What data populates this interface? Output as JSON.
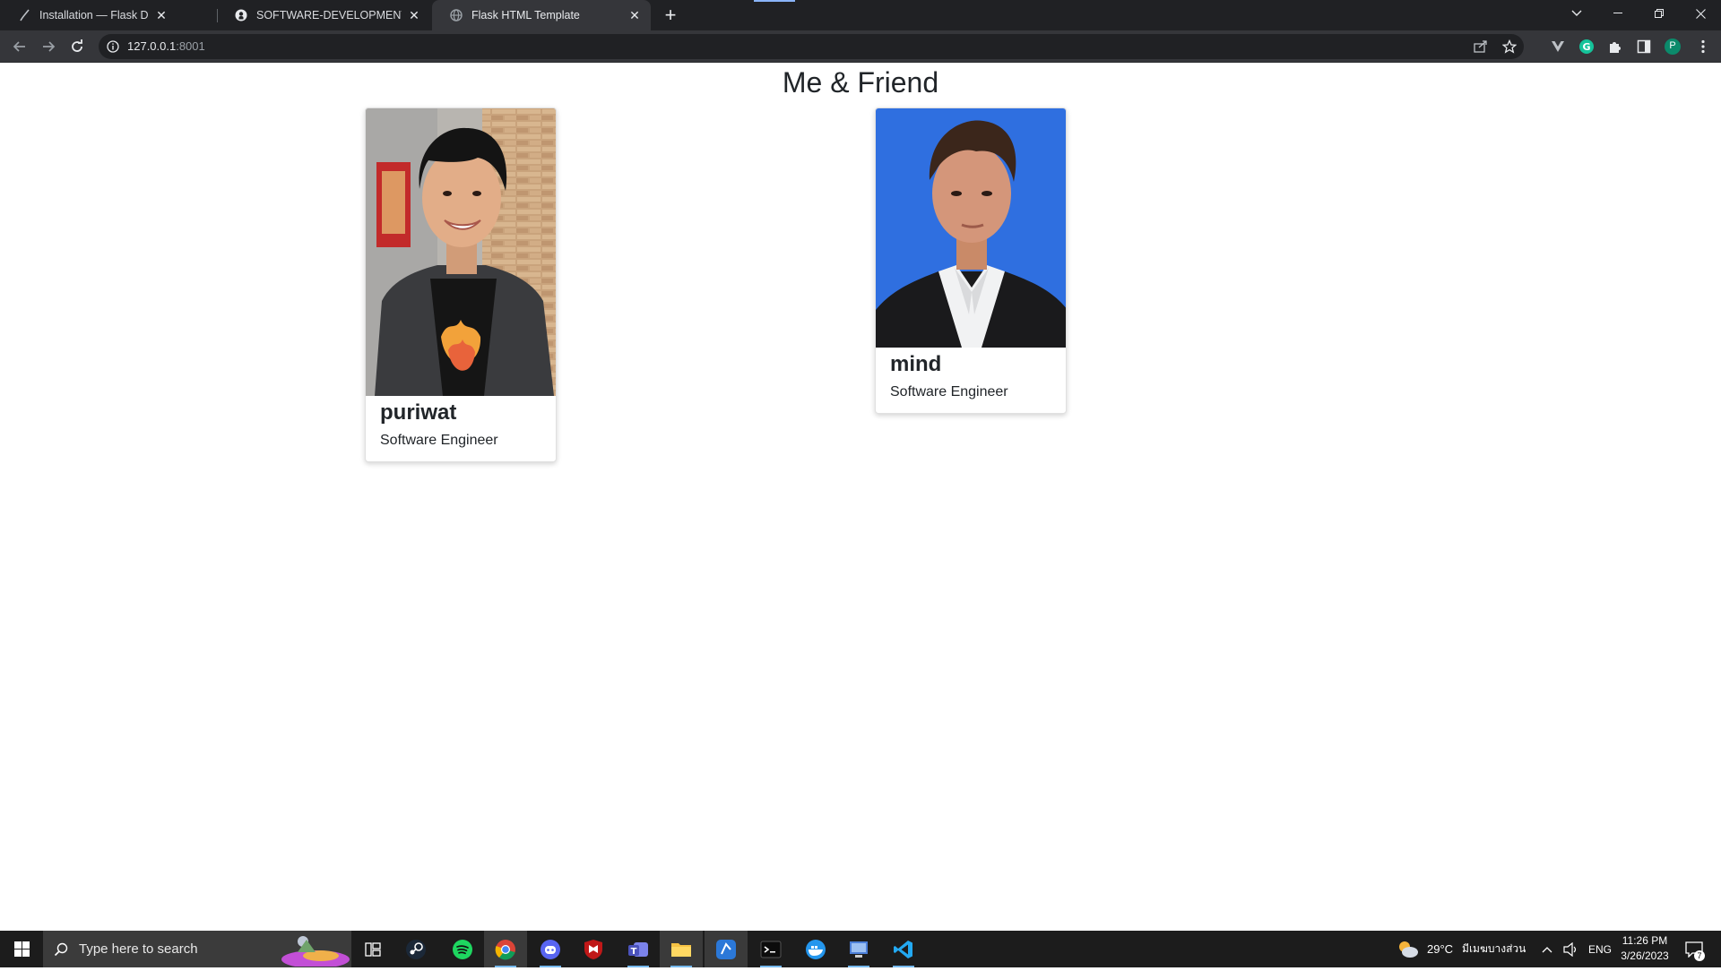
{
  "browser": {
    "tabs": [
      {
        "title": "Installation — Flask Documentati",
        "favicon": "flask-icon"
      },
      {
        "title": "SOFTWARE-DEVELOPMENT-TOO",
        "favicon": "github-icon"
      },
      {
        "title": "Flask HTML Template",
        "favicon": "globe-icon"
      }
    ],
    "url_host": "127.0.0.1",
    "url_port": ":8001",
    "profile_initial": "P"
  },
  "page": {
    "title": "Me & Friend",
    "cards": [
      {
        "name": "puriwat",
        "role": "Software Engineer"
      },
      {
        "name": "mind",
        "role": "Software Engineer"
      }
    ]
  },
  "taskbar": {
    "search_placeholder": "Type here to search",
    "weather_temp": "29°C",
    "weather_desc": "มีเมฆบางส่วน",
    "language": "ENG",
    "time": "11:26 PM",
    "date": "3/26/2023",
    "notification_count": "7"
  },
  "colors": {
    "chrome_dark": "#202124",
    "chrome_toolbar": "#35363a",
    "photo_bg_blue": "#2f6fe0",
    "taskbar_bg": "#1c1c1c"
  }
}
